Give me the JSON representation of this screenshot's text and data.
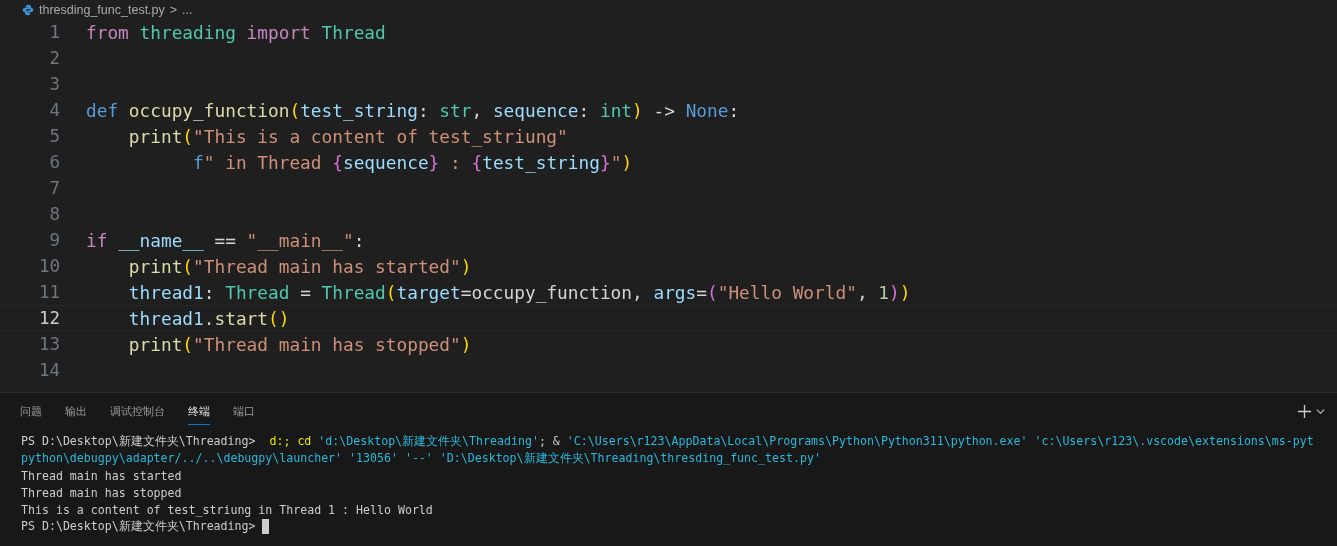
{
  "breadcrumb": {
    "file": "thresding_func_test.py",
    "separator": ">",
    "more": "..."
  },
  "code_lines": [
    {
      "number": "1",
      "current": false,
      "tokens": [
        {
          "kind": "keyword",
          "text": "from "
        },
        {
          "kind": "type",
          "text": "threading "
        },
        {
          "kind": "keyword",
          "text": "import "
        },
        {
          "kind": "type",
          "text": "Thread"
        }
      ]
    },
    {
      "number": "2",
      "current": false
    },
    {
      "number": "3",
      "current": false
    },
    {
      "number": "4",
      "current": false,
      "tokens": [
        {
          "kind": "storage",
          "text": "def "
        },
        {
          "kind": "function",
          "text": "occupy_function"
        },
        {
          "kind": "paren",
          "text": "("
        },
        {
          "kind": "variable",
          "text": "test_string"
        },
        {
          "kind": "plain",
          "text": ": "
        },
        {
          "kind": "type",
          "text": "str"
        },
        {
          "kind": "plain",
          "text": ", "
        },
        {
          "kind": "variable",
          "text": "sequence"
        },
        {
          "kind": "plain",
          "text": ": "
        },
        {
          "kind": "type",
          "text": "int"
        },
        {
          "kind": "paren",
          "text": ")"
        },
        {
          "kind": "plain",
          "text": " -> "
        },
        {
          "kind": "storage",
          "text": "None"
        },
        {
          "kind": "plain",
          "text": ":"
        }
      ]
    },
    {
      "number": "5",
      "current": false,
      "tokens": [
        {
          "kind": "function",
          "text": "    print"
        },
        {
          "kind": "paren",
          "text": "("
        },
        {
          "kind": "string",
          "text": "\"This is a content of test_striung\""
        }
      ]
    },
    {
      "number": "6",
      "current": false,
      "tokens": [
        {
          "kind": "storage",
          "text": "          f"
        },
        {
          "kind": "string",
          "text": "\" in Thread "
        },
        {
          "kind": "brace",
          "text": "{"
        },
        {
          "kind": "variable",
          "text": "sequence"
        },
        {
          "kind": "brace",
          "text": "}"
        },
        {
          "kind": "string",
          "text": " : "
        },
        {
          "kind": "brace",
          "text": "{"
        },
        {
          "kind": "variable",
          "text": "test_string"
        },
        {
          "kind": "brace",
          "text": "}"
        },
        {
          "kind": "string",
          "text": "\""
        },
        {
          "kind": "paren",
          "text": ")"
        }
      ]
    },
    {
      "number": "7",
      "current": false
    },
    {
      "number": "8",
      "current": false
    },
    {
      "number": "9",
      "current": false,
      "tokens": [
        {
          "kind": "keyword",
          "text": "if "
        },
        {
          "kind": "variable",
          "text": "__name__"
        },
        {
          "kind": "plain",
          "text": " == "
        },
        {
          "kind": "string",
          "text": "\"__main__\""
        },
        {
          "kind": "plain",
          "text": ":"
        }
      ]
    },
    {
      "number": "10",
      "current": false,
      "tokens": [
        {
          "kind": "function",
          "text": "    print"
        },
        {
          "kind": "paren",
          "text": "("
        },
        {
          "kind": "string",
          "text": "\"Thread main has started\""
        },
        {
          "kind": "paren",
          "text": ")"
        }
      ]
    },
    {
      "number": "11",
      "current": false,
      "tokens": [
        {
          "kind": "variable",
          "text": "    thread1"
        },
        {
          "kind": "plain",
          "text": ": "
        },
        {
          "kind": "type",
          "text": "Thread"
        },
        {
          "kind": "plain",
          "text": " = "
        },
        {
          "kind": "type",
          "text": "Thread"
        },
        {
          "kind": "paren",
          "text": "("
        },
        {
          "kind": "variable",
          "text": "target"
        },
        {
          "kind": "plain",
          "text": "=occupy_function, "
        },
        {
          "kind": "variable",
          "text": "args"
        },
        {
          "kind": "plain",
          "text": "="
        },
        {
          "kind": "brace",
          "text": "("
        },
        {
          "kind": "string",
          "text": "\"Hello World\""
        },
        {
          "kind": "plain",
          "text": ", "
        },
        {
          "kind": "number",
          "text": "1"
        },
        {
          "kind": "brace",
          "text": ")"
        },
        {
          "kind": "paren",
          "text": ")"
        }
      ]
    },
    {
      "number": "12",
      "current": true,
      "tokens": [
        {
          "kind": "variable",
          "text": "    thread1"
        },
        {
          "kind": "plain",
          "text": "."
        },
        {
          "kind": "function",
          "text": "start"
        },
        {
          "kind": "paren",
          "text": "()"
        }
      ]
    },
    {
      "number": "13",
      "current": false,
      "tokens": [
        {
          "kind": "function",
          "text": "    print"
        },
        {
          "kind": "paren",
          "text": "("
        },
        {
          "kind": "string",
          "text": "\"Thread main has stopped\""
        },
        {
          "kind": "paren",
          "text": ")"
        }
      ]
    },
    {
      "number": "14",
      "current": false
    }
  ],
  "panel_tabs": [
    {
      "label": "问题",
      "selected": false
    },
    {
      "label": "输出",
      "selected": false
    },
    {
      "label": "调试控制台",
      "selected": false
    },
    {
      "label": "终端",
      "selected": true
    },
    {
      "label": "端口",
      "selected": false
    }
  ],
  "terminal": [
    {
      "cursor": false,
      "segments": [
        {
          "kind": "plain",
          "text": "PS D:\\Desktop\\新建文件夹\\Threading>  "
        },
        {
          "kind": "command",
          "text": "d:; cd "
        },
        {
          "kind": "path",
          "text": "'d:\\Desktop\\新建文件夹\\Threading'"
        },
        {
          "kind": "plain",
          "text": "; & "
        },
        {
          "kind": "path",
          "text": "'C:\\Users\\r123\\AppData\\Local\\Programs\\Python\\Python311\\python.exe' 'c:\\Users\\r123\\.vscode\\extensions\\ms-pyt"
        }
      ]
    },
    {
      "cursor": false,
      "segments": [
        {
          "kind": "path",
          "text": "python\\debugpy\\adapter/../..\\debugpy\\launcher' '13056' '--' 'D:\\Desktop\\新建文件夹\\Threading\\thresding_func_test.py'"
        }
      ]
    },
    {
      "cursor": false,
      "segments": [
        {
          "kind": "plain",
          "text": "Thread main has started"
        }
      ]
    },
    {
      "cursor": false,
      "segments": [
        {
          "kind": "plain",
          "text": "Thread main has stopped"
        }
      ]
    },
    {
      "cursor": false,
      "segments": [
        {
          "kind": "plain",
          "text": "This is a content of test_striung in Thread 1 : Hello World"
        }
      ]
    },
    {
      "cursor": true,
      "segments": [
        {
          "kind": "plain",
          "text": "PS D:\\Desktop\\新建文件夹\\Threading> "
        }
      ]
    }
  ]
}
